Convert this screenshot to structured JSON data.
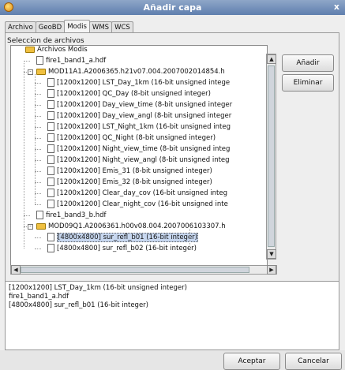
{
  "window": {
    "title": "Añadir capa",
    "close_label": "x"
  },
  "tabs": [
    {
      "label": "Archivo",
      "active": false
    },
    {
      "label": "GeoBD",
      "active": false
    },
    {
      "label": "Modis",
      "active": true
    },
    {
      "label": "WMS",
      "active": false
    },
    {
      "label": "WCS",
      "active": false
    }
  ],
  "panel": {
    "label": "Seleccion de archivos"
  },
  "tree": [
    {
      "label": "Archivos Modis",
      "icon": "folder",
      "indent": 0,
      "expander": null
    },
    {
      "label": "fire1_band1_a.hdf",
      "icon": "doc",
      "indent": 1,
      "expander": null
    },
    {
      "label": "MOD11A1.A2006365.h21v07.004.2007002014854.h",
      "icon": "folder",
      "indent": 1,
      "expander": "-"
    },
    {
      "label": "[1200x1200] LST_Day_1km (16-bit unsigned intege",
      "icon": "doc",
      "indent": 2,
      "expander": null
    },
    {
      "label": "[1200x1200] QC_Day (8-bit unsigned integer)",
      "icon": "doc",
      "indent": 2,
      "expander": null
    },
    {
      "label": "[1200x1200] Day_view_time (8-bit unsigned integer",
      "icon": "doc",
      "indent": 2,
      "expander": null
    },
    {
      "label": "[1200x1200] Day_view_angl (8-bit unsigned integer",
      "icon": "doc",
      "indent": 2,
      "expander": null
    },
    {
      "label": "[1200x1200] LST_Night_1km (16-bit unsigned integ",
      "icon": "doc",
      "indent": 2,
      "expander": null
    },
    {
      "label": "[1200x1200] QC_Night (8-bit unsigned integer)",
      "icon": "doc",
      "indent": 2,
      "expander": null
    },
    {
      "label": "[1200x1200] Night_view_time (8-bit unsigned integ",
      "icon": "doc",
      "indent": 2,
      "expander": null
    },
    {
      "label": "[1200x1200] Night_view_angl (8-bit unsigned integ",
      "icon": "doc",
      "indent": 2,
      "expander": null
    },
    {
      "label": "[1200x1200] Emis_31 (8-bit unsigned integer)",
      "icon": "doc",
      "indent": 2,
      "expander": null
    },
    {
      "label": "[1200x1200] Emis_32 (8-bit unsigned integer)",
      "icon": "doc",
      "indent": 2,
      "expander": null
    },
    {
      "label": "[1200x1200] Clear_day_cov (16-bit unsigned integ",
      "icon": "doc",
      "indent": 2,
      "expander": null
    },
    {
      "label": "[1200x1200] Clear_night_cov (16-bit unsigned inte",
      "icon": "doc",
      "indent": 2,
      "expander": null
    },
    {
      "label": "fire1_band3_b.hdf",
      "icon": "doc",
      "indent": 1,
      "expander": null
    },
    {
      "label": "MOD09Q1.A2006361.h00v08.004.2007006103307.h",
      "icon": "folder",
      "indent": 1,
      "expander": "-"
    },
    {
      "label": "[4800x4800] sur_refl_b01 (16-bit integer)",
      "icon": "doc",
      "indent": 2,
      "expander": null,
      "selected": true
    },
    {
      "label": "[4800x4800] sur_refl_b02 (16-bit integer)",
      "icon": "doc",
      "indent": 2,
      "expander": null
    }
  ],
  "buttons": {
    "add": "Añadir",
    "remove": "Eliminar",
    "accept": "Aceptar",
    "cancel": "Cancelar"
  },
  "output_lines": [
    "[1200x1200] LST_Day_1km (16-bit unsigned integer)",
    "fire1_band1_a.hdf",
    "[4800x4800] sur_refl_b01 (16-bit integer)"
  ],
  "colors": {
    "title_bar": "#6d8ab8",
    "selection": "#c7d7ef"
  }
}
